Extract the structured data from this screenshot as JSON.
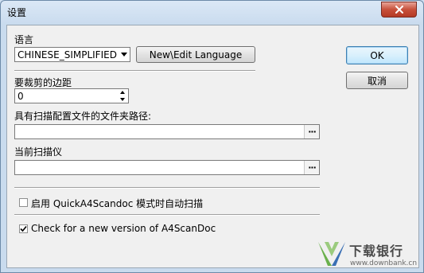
{
  "window": {
    "title": "设置"
  },
  "language": {
    "label": "语言",
    "selected": "CHINESE_SIMPLIFIED",
    "edit_button": "New\\Edit Language"
  },
  "buttons": {
    "ok": "OK",
    "cancel": "取消"
  },
  "margin": {
    "label": "要裁剪的边距",
    "value": "0"
  },
  "config_folder": {
    "label": "具有扫描配置文件的文件夹路径:",
    "value": "",
    "browse": "···"
  },
  "scanner": {
    "label": "当前扫描仪",
    "value": "",
    "browse": "···"
  },
  "options": {
    "auto_scan": {
      "label": "启用 QuickA4Scandoc 模式时自动扫描",
      "checked": false
    },
    "check_update": {
      "label": "Check for a new version of A4ScanDoc",
      "checked": true
    }
  },
  "watermark": {
    "brand": "下载银行",
    "url": "www.downbank.cn"
  },
  "colors": {
    "accent": "#3c7fb1",
    "close": "#c7503a",
    "watermark_green": "#6ab04c",
    "watermark_blue": "#3a6fb4"
  }
}
